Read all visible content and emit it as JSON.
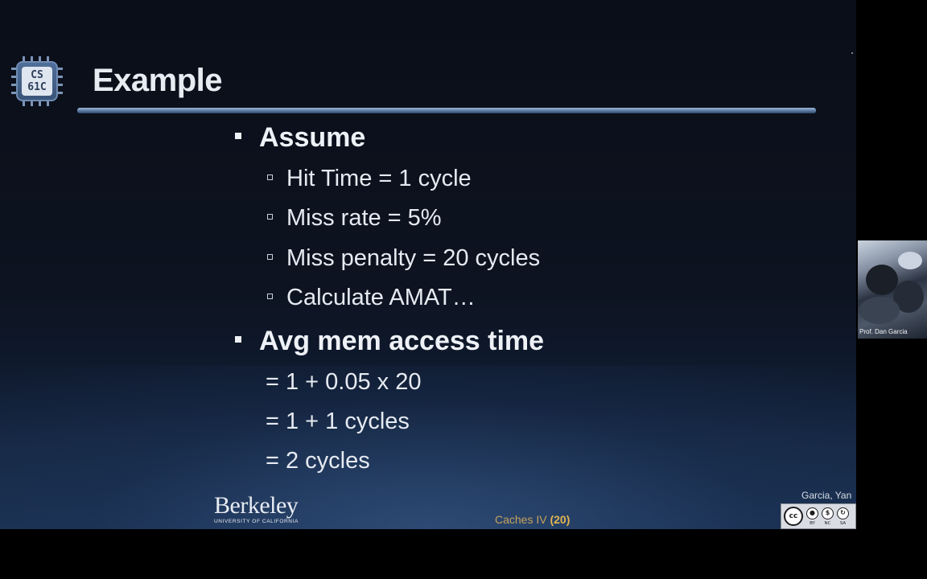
{
  "slide": {
    "logo_text_line1": "CS",
    "logo_text_line2": "61C",
    "title": "Example",
    "bullets": [
      {
        "label": "Assume",
        "sub": [
          "Hit Time = 1 cycle",
          "Miss rate = 5%",
          "Miss penalty = 20 cycles",
          "Calculate AMAT…"
        ]
      },
      {
        "label": "Avg mem access time",
        "lines": [
          "= 1 + 0.05 x 20",
          "= 1 + 1 cycles",
          "= 2 cycles"
        ]
      }
    ],
    "footer": {
      "university": "Berkeley",
      "university_sub": "UNIVERSITY OF CALIFORNIA",
      "lecture": "Caches IV",
      "page": "(20)",
      "authors": "Garcia, Yan",
      "license": {
        "main": "cc",
        "by": "BY",
        "nc": "NC",
        "sa": "SA"
      }
    }
  },
  "webcam": {
    "caption": "Prof. Dan Garcia"
  },
  "colors": {
    "background": "#000000",
    "slide_bg": "#0d1320",
    "title_text": "#e8ecf2",
    "accent_gold": "#e2b653"
  }
}
